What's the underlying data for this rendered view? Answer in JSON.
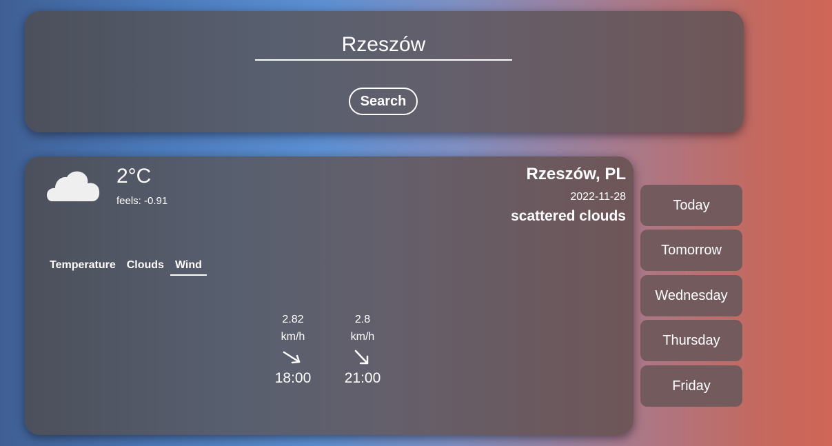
{
  "search": {
    "value": "Rzeszów",
    "button_label": "Search"
  },
  "current": {
    "icon": "cloud-icon",
    "temperature": "2°C",
    "feels": "feels: -0.91",
    "location": "Rzeszów, PL",
    "date": "2022-11-28",
    "description": "scattered clouds"
  },
  "tabs": [
    {
      "label": "Temperature",
      "active": false
    },
    {
      "label": "Clouds",
      "active": false
    },
    {
      "label": "Wind",
      "active": true
    }
  ],
  "wind": [
    {
      "speed": "2.82",
      "unit": "km/h",
      "time": "18:00",
      "direction": "south-east"
    },
    {
      "speed": "2.8",
      "unit": "km/h",
      "time": "21:00",
      "direction": "south-east"
    }
  ],
  "days": [
    "Today",
    "Tomorrow",
    "Wednesday",
    "Thursday",
    "Friday"
  ]
}
